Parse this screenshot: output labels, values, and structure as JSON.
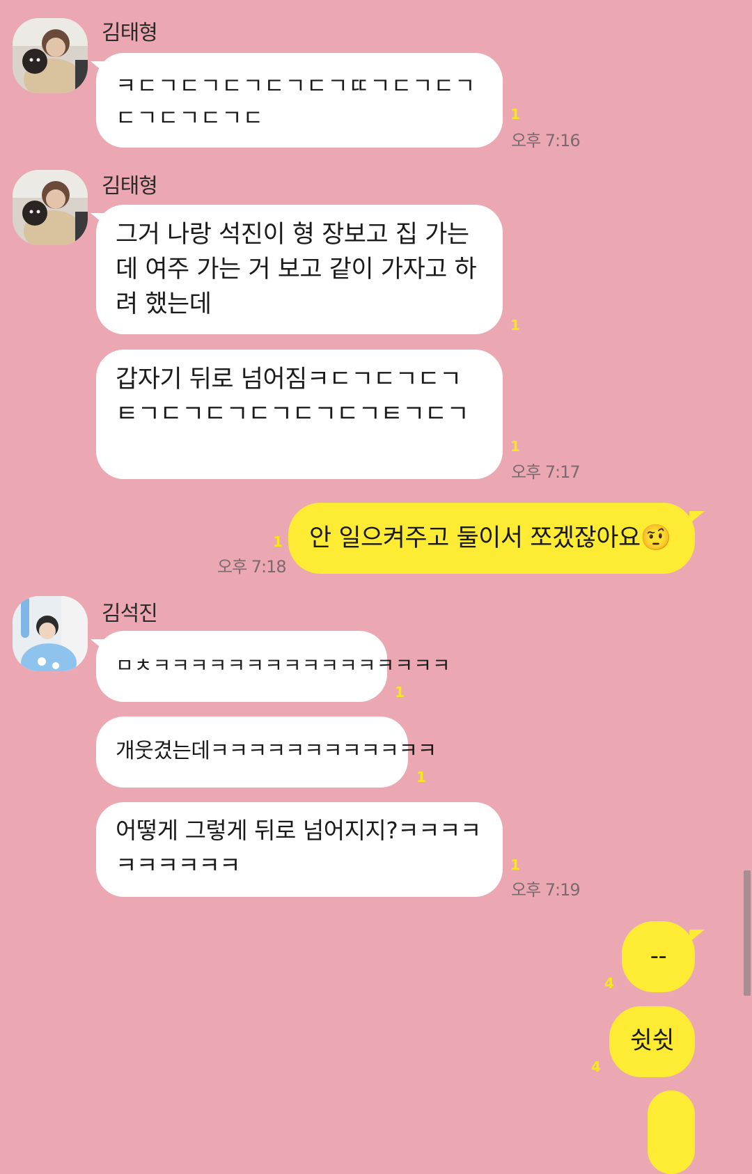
{
  "chat": {
    "background": "#EBA8B2",
    "my_bubble_color": "#FEEC34",
    "unread_color": "#F5E71A",
    "groups": [
      {
        "sender": "김태형",
        "messages": [
          {
            "text": "ㅋㄷㄱㄷㄱㄷㄱㄷㄱㄷㄱㄸㄱㄷㄱㄷㄱㄷㄱㄷㄱㄷㄱㄷ",
            "unread": "1",
            "time": "오후 7:16"
          }
        ]
      },
      {
        "sender": "김태형",
        "messages": [
          {
            "text": "그거 나랑 석진이 형 장보고 집 가는데 여주 가는 거 보고 같이 가자고 하려 했는데",
            "unread": "1",
            "time": ""
          },
          {
            "text": "갑자기 뒤로 넘어짐ㅋㄷㄱㄷㄱㄷㄱㅌㄱㄷㄱㄷㄱㄷㄱㄷㄱㄷㄱㅌㄱㄷㄱ",
            "unread": "1",
            "time": "오후 7:17"
          }
        ]
      },
      {
        "sender": "",
        "mine": true,
        "messages": [
          {
            "text": "안 일으켜주고 둘이서 쪼겠잖아요",
            "emoji": "🤨",
            "unread": "1",
            "time": "오후 7:18"
          }
        ]
      },
      {
        "sender": "김석진",
        "messages": [
          {
            "text": "ㅁㅊㅋㅋㅋㅋㅋㅋㅋㅋㅋㅋㅋㅋㅋㅋㅋㅋ",
            "unread": "1",
            "time": ""
          },
          {
            "text": "개웃겼는데ㅋㅋㅋㅋㅋㅋㅋㅋㅋㅋㅋㅋ",
            "unread": "1",
            "time": ""
          },
          {
            "text": "어떻게 그렇게 뒤로 넘어지지?ㅋㅋㅋㅋㅋㅋㅋㅋㅋㅋ",
            "unread": "1",
            "time": "오후 7:19"
          }
        ]
      },
      {
        "sender": "",
        "mine": true,
        "messages": [
          {
            "text": "--",
            "unread": "4",
            "time": ""
          },
          {
            "text": "쉿쉿",
            "unread": "4",
            "time": ""
          }
        ]
      }
    ]
  }
}
